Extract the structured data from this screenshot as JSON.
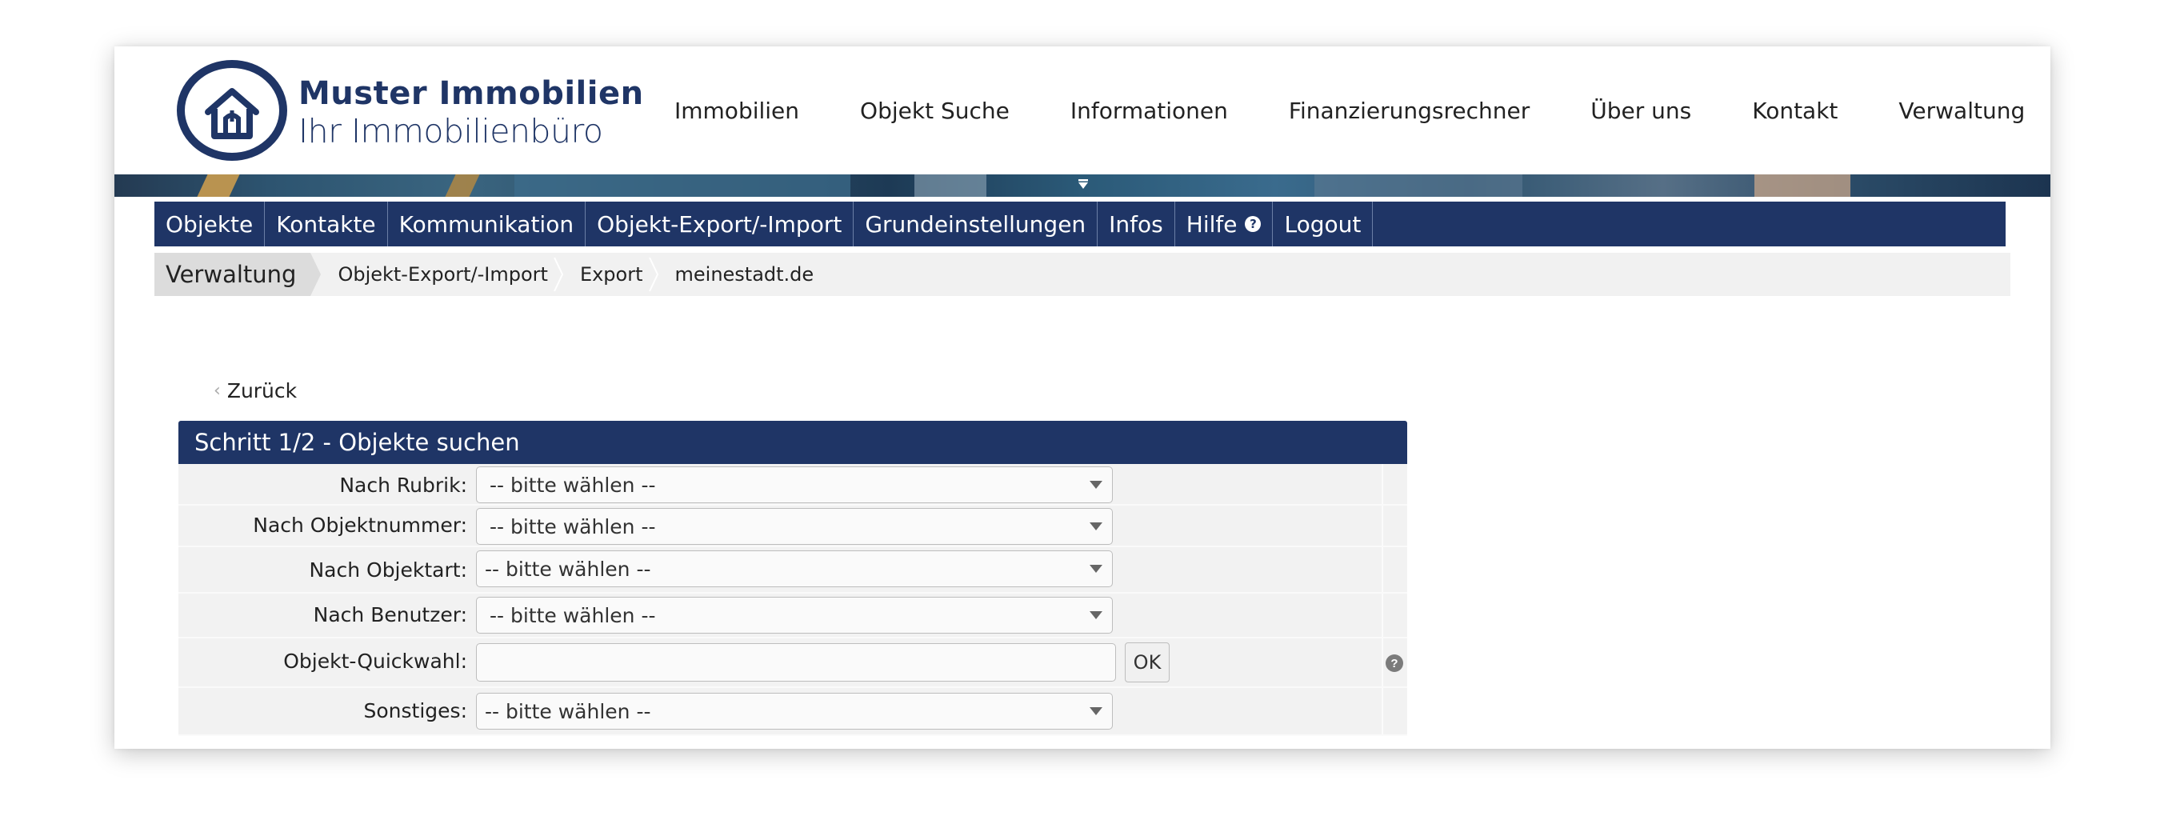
{
  "logo": {
    "line1": "Muster Immobilien",
    "line2": "Ihr Immobilienbüro"
  },
  "main_nav": [
    "Immobilien",
    "Objekt Suche",
    "Informationen",
    "Finanzierungsrechner",
    "Über uns",
    "Kontakt",
    "Verwaltung"
  ],
  "admin_nav": [
    "Objekte",
    "Kontakte",
    "Kommunikation",
    "Objekt-Export/-Import",
    "Grundeinstellungen",
    "Infos",
    "Hilfe",
    "Logout"
  ],
  "breadcrumb": [
    "Verwaltung",
    "Objekt-Export/-Import",
    "Export",
    "meinestadt.de"
  ],
  "back_label": "Zurück",
  "panel": {
    "title": "Schritt 1/2 - Objekte suchen",
    "fields": [
      {
        "label": "Nach Rubrik:",
        "value": "-- bitte wählen --"
      },
      {
        "label": "Nach Objektnummer:",
        "value": "-- bitte wählen --"
      },
      {
        "label": "Nach Objektart:",
        "value": "-- bitte wählen --"
      },
      {
        "label": "Nach Benutzer:",
        "value": "-- bitte wählen --"
      },
      {
        "label": "Objekt-Quickwahl:",
        "value": "",
        "button": "OK"
      },
      {
        "label": "Sonstiges:",
        "value": "-- bitte wählen --"
      }
    ]
  },
  "colors": {
    "brand_navy": "#1f3566",
    "breadcrumb_bg": "#f1f1f1",
    "form_bg": "#f2f2f2"
  },
  "icons": {
    "logo": "house-in-circle-icon",
    "banner_toggle": "caret-down-icon",
    "help": "question-circle-icon",
    "back": "chevron-left-icon"
  }
}
